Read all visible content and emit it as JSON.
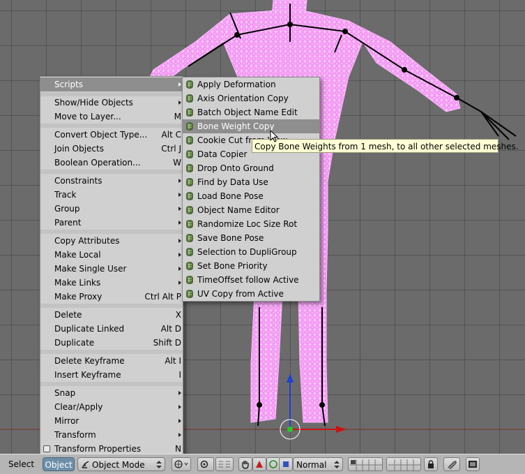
{
  "object_menu": {
    "items": [
      {
        "label": "Scripts",
        "shortcut": "",
        "submenu": true,
        "highlighted": true
      },
      {
        "label": "Show/Hide Objects",
        "shortcut": "",
        "submenu": true
      },
      {
        "label": "Move to Layer...",
        "shortcut": "M",
        "submenu": false
      },
      {
        "label": "Convert Object Type...",
        "shortcut": "Alt C",
        "submenu": false
      },
      {
        "label": "Join Objects",
        "shortcut": "Ctrl J",
        "submenu": false
      },
      {
        "label": "Boolean Operation...",
        "shortcut": "W",
        "submenu": false
      },
      {
        "label": "Constraints",
        "shortcut": "",
        "submenu": true
      },
      {
        "label": "Track",
        "shortcut": "",
        "submenu": true
      },
      {
        "label": "Group",
        "shortcut": "",
        "submenu": true
      },
      {
        "label": "Parent",
        "shortcut": "",
        "submenu": true
      },
      {
        "label": "Copy Attributes",
        "shortcut": "",
        "submenu": true
      },
      {
        "label": "Make Local",
        "shortcut": "",
        "submenu": true
      },
      {
        "label": "Make Single User",
        "shortcut": "",
        "submenu": true
      },
      {
        "label": "Make Links",
        "shortcut": "",
        "submenu": true
      },
      {
        "label": "Make Proxy",
        "shortcut": "Ctrl Alt P",
        "submenu": false
      },
      {
        "label": "Delete",
        "shortcut": "X",
        "submenu": false
      },
      {
        "label": "Duplicate Linked",
        "shortcut": "Alt D",
        "submenu": false
      },
      {
        "label": "Duplicate",
        "shortcut": "Shift D",
        "submenu": false
      },
      {
        "label": "Delete Keyframe",
        "shortcut": "Alt I",
        "submenu": false
      },
      {
        "label": "Insert Keyframe",
        "shortcut": "I",
        "submenu": false
      },
      {
        "label": "Snap",
        "shortcut": "",
        "submenu": true
      },
      {
        "label": "Clear/Apply",
        "shortcut": "",
        "submenu": true
      },
      {
        "label": "Mirror",
        "shortcut": "",
        "submenu": true
      },
      {
        "label": "Transform",
        "shortcut": "",
        "submenu": true
      },
      {
        "label": "Transform Properties",
        "shortcut": "N",
        "submenu": false,
        "checkbox": true
      }
    ]
  },
  "scripts_menu": {
    "items": [
      {
        "label": "Apply Deformation"
      },
      {
        "label": "Axis Orientation Copy"
      },
      {
        "label": "Batch Object Name Edit"
      },
      {
        "label": "Bone Weight Copy",
        "highlighted": true
      },
      {
        "label": "Cookie Cut from View"
      },
      {
        "label": "Data Copier"
      },
      {
        "label": "Drop Onto Ground"
      },
      {
        "label": "Find by Data Use"
      },
      {
        "label": "Load Bone Pose"
      },
      {
        "label": "Object Name Editor"
      },
      {
        "label": "Randomize Loc Size Rot"
      },
      {
        "label": "Save Bone Pose"
      },
      {
        "label": "Selection to DupliGroup"
      },
      {
        "label": "Set Bone Priority"
      },
      {
        "label": "TimeOffset follow Active"
      },
      {
        "label": "UV Copy from Active"
      }
    ]
  },
  "tooltip": {
    "text": "Copy Bone Weights from 1 mesh, to all other selected meshes."
  },
  "header": {
    "select_label": "Select",
    "object_label": "Object",
    "mode": "Object Mode",
    "shading": "Normal"
  },
  "colors": {
    "mesh_wire": "#f08cf0",
    "viewport_bg": "#6b6b6b",
    "menu_bg": "#d0d0d0",
    "menu_highlight": "#8e8e8e",
    "tooltip_bg": "#ffffd5",
    "axis_x": "#d01010",
    "axis_z": "#1f3fd6"
  },
  "icons": {
    "script_item": "python-script-icon",
    "mode": "object-mode-icon",
    "pivot": "pivot-icon",
    "snap": "magnet-icon",
    "render": "render-icon"
  }
}
